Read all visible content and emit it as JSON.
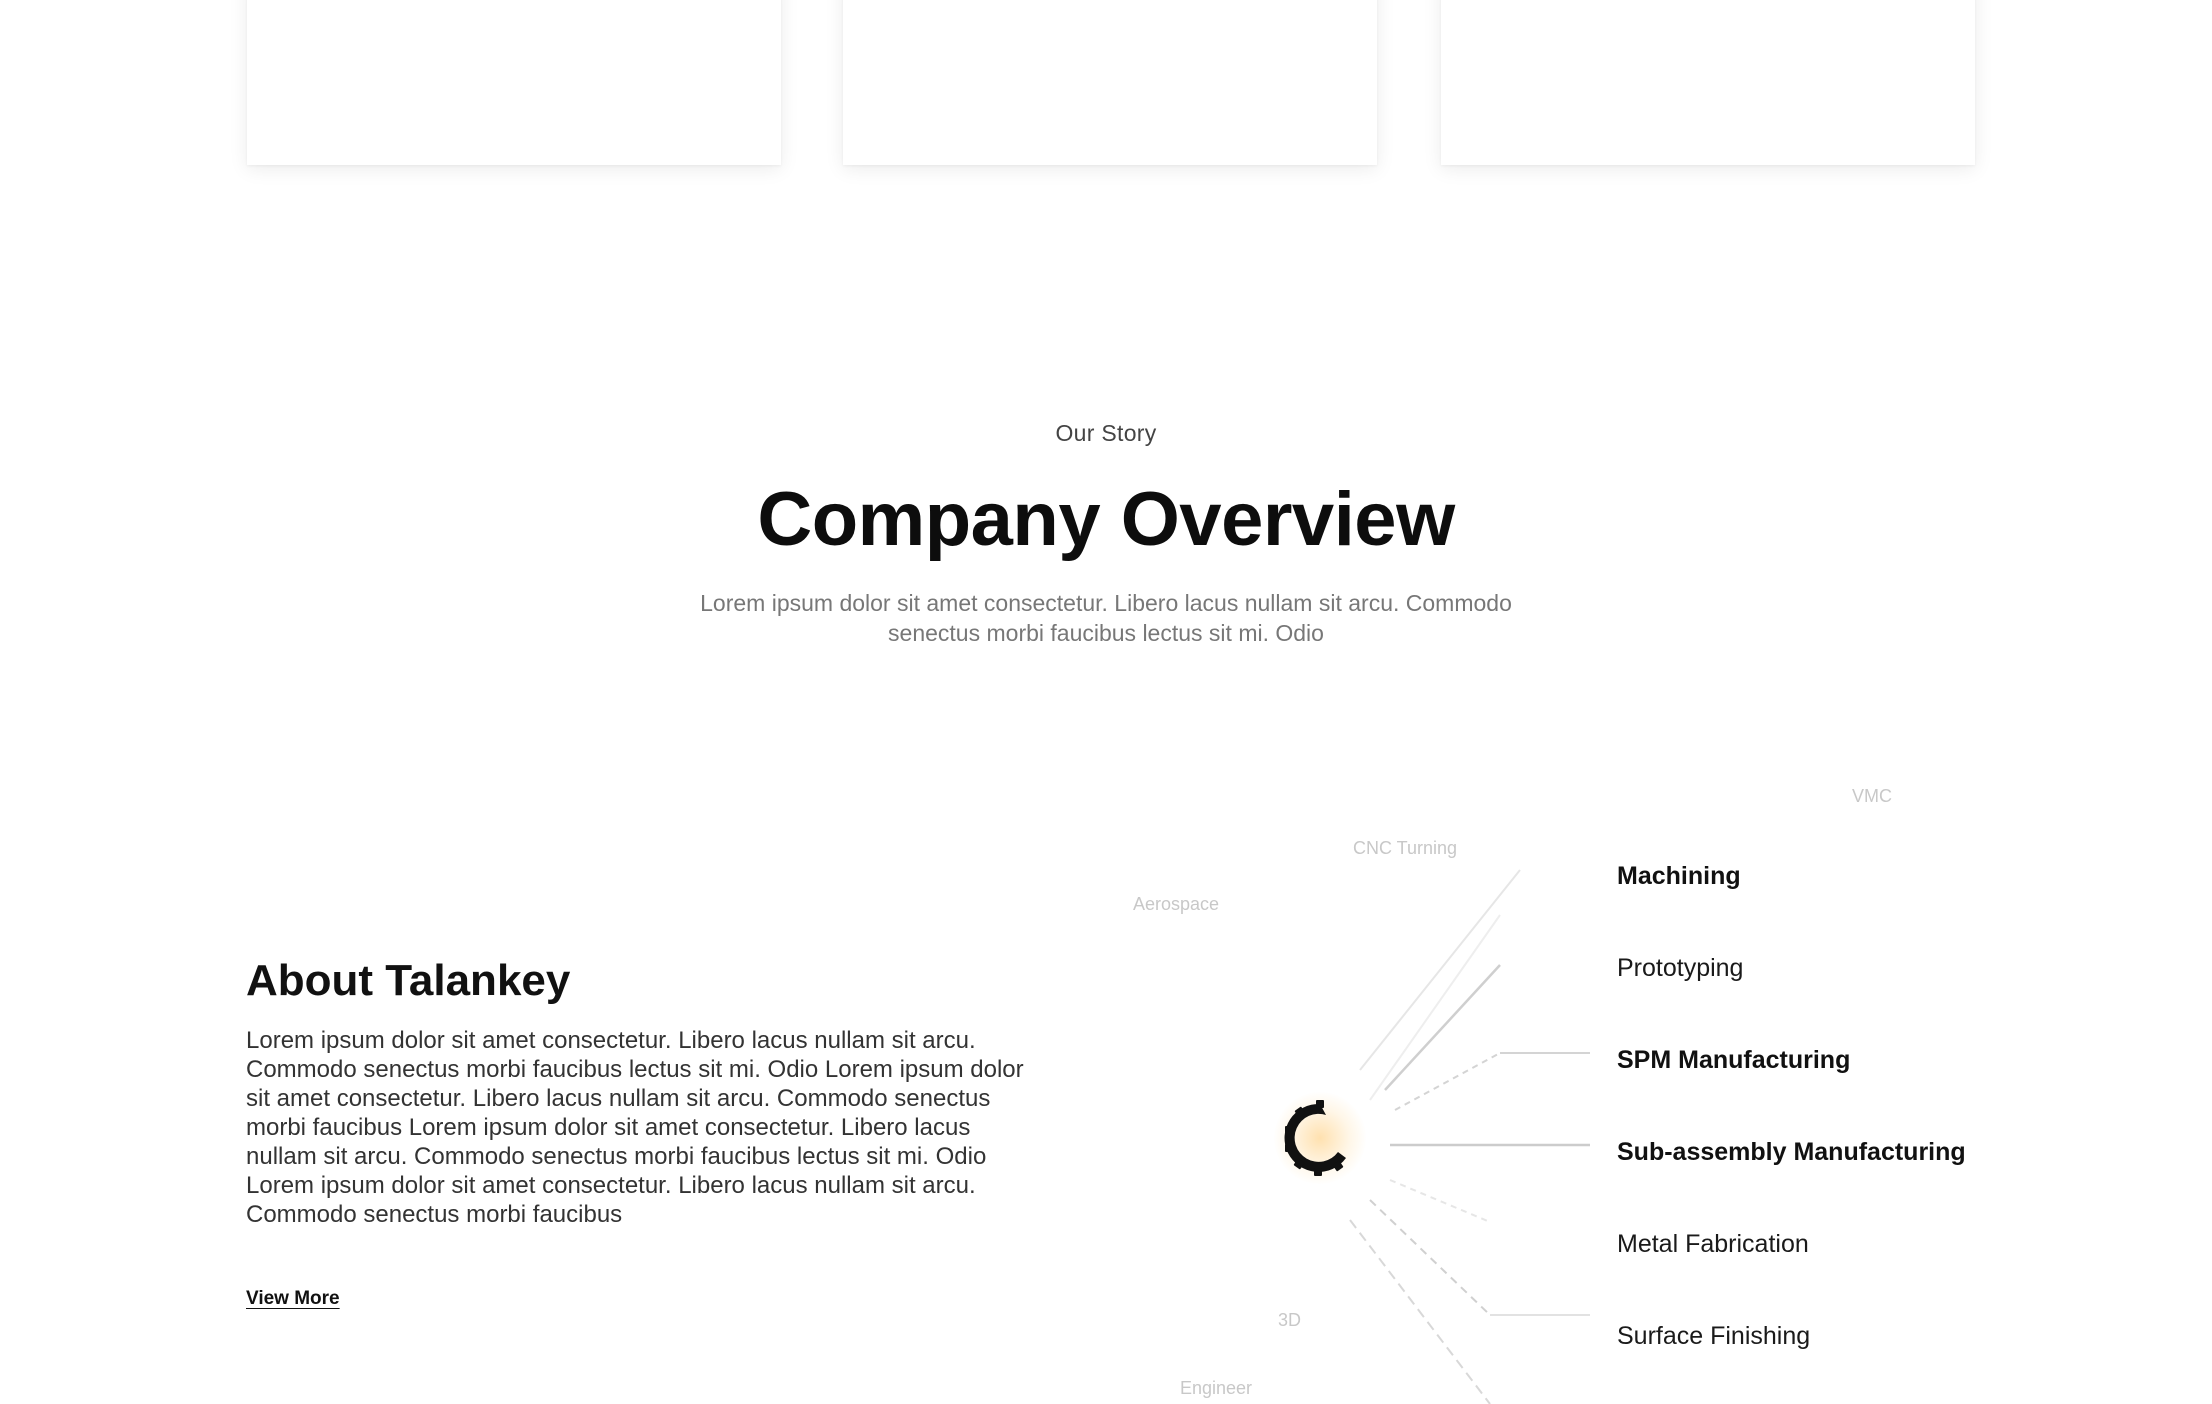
{
  "overview": {
    "eyebrow": "Our Story",
    "title": "Company Overview",
    "description": "Lorem ipsum dolor sit amet consectetur. Libero lacus nullam sit arcu. Commodo senectus morbi faucibus lectus sit mi. Odio"
  },
  "about": {
    "title": "About Talankey",
    "body": "Lorem ipsum dolor sit amet consectetur. Libero lacus nullam sit arcu. Commodo senectus morbi faucibus lectus sit mi. Odio Lorem ipsum dolor sit amet consectetur. Libero lacus nullam sit arcu. Commodo senectus morbi faucibus Lorem ipsum dolor sit amet consectetur. Libero lacus nullam sit arcu. Commodo senectus morbi faucibus lectus sit mi. Odio Lorem ipsum dolor sit amet consectetur. Libero lacus nullam sit arcu. Commodo senectus morbi faucibus",
    "link": "View More"
  },
  "services": {
    "items": [
      "Machining",
      "Prototyping",
      "SPM Manufacturing",
      "Sub-assembly Manufacturing",
      "Metal Fabrication",
      "Surface Finishing"
    ],
    "faint_labels": {
      "top_right": "VMC",
      "cnc": "CNC Turning",
      "aerospace": "Aerospace",
      "mid_bottom": "3D",
      "bottom": "Engineer"
    },
    "accent_color": "#f5b24a"
  }
}
